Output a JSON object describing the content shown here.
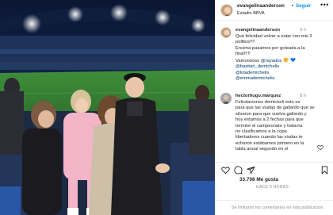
{
  "post": {
    "author": "evangelinaanderson",
    "follow_label": "Seguir",
    "location": "Estadio BBVA",
    "more_icon": "more-horizontal-icon"
  },
  "caption": {
    "user": "evangelinaanderson",
    "time": "9 h",
    "lines": [
      "Qué felicidad volver a estar con mis 3",
      "pollitos!!!!",
      "Encima pasamos por goleada a la",
      "final!!!!!",
      "Vamooooss",
      "@bastian_demichelis",
      "@lolademichelis",
      "@emmademichelis"
    ],
    "mention_rayados": "@rayados"
  },
  "comment": {
    "user": "hectorhugo.marquez",
    "time": "8 h",
    "lines": [
      "Felicitaciones demicheli esto es",
      "para que las viudas de gallardo que se",
      "silvaron para que vuelva gallardo y",
      "hoy estamos a 2 fechas para que",
      "termine el campeonato y todavía",
      "no clasificamos a la copa",
      "libertadores cuando las viudas te",
      "echaron estábamos primero en la",
      "tabla anual segundo en el"
    ]
  },
  "actions": {
    "icons": [
      "heart-icon",
      "comment-icon",
      "share-icon",
      "bookmark-icon"
    ]
  },
  "likes": "33.708 Me gusta",
  "date": "HACE 9 HORAS",
  "footer": "Se limitaron los comentarios en esta publicación.",
  "colors": {
    "accent": "#0095f6",
    "text": "#262626",
    "muted": "#8e8e8e",
    "mention": "#00376b"
  }
}
